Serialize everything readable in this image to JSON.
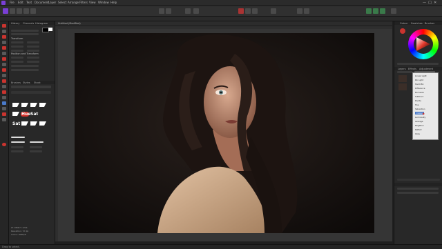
{
  "app": {
    "name": "Affinity Photo",
    "menu": [
      "File",
      "Edit",
      "Text",
      "Document",
      "Layer",
      "Select",
      "Arrange",
      "Filters",
      "View",
      "Window",
      "Help"
    ]
  },
  "left_panel": {
    "tabs": [
      "History",
      "Channels",
      "Histogram"
    ],
    "section_transform": "Transform",
    "section_position": "Position and Transform",
    "styles_tabs": [
      "Brushes",
      "Styles",
      "Stock"
    ],
    "swatch_labels": [
      "Hue",
      "Sat",
      "Sat"
    ],
    "info_lines": [
      "W: 1866 H: 1244",
      "Resolution: 72 dpi",
      "Colour: RGBA/8"
    ]
  },
  "document": {
    "tab_label": "Untitled (Modified)"
  },
  "right_panel": {
    "tabs": [
      "Colour",
      "Swatches",
      "Brushes"
    ],
    "layer_tabs": [
      "Layers",
      "Effects",
      "Adjustment"
    ],
    "blend_modes": [
      "Linear Light",
      "Pin Light",
      "Hard Mix",
      "Difference",
      "Exclusion",
      "Subtract",
      "Divide",
      "Hue",
      "Saturation",
      "Colour",
      "Luminosity",
      "Average",
      "Negation",
      "Reflect",
      "Glow"
    ]
  },
  "status": {
    "text": "Drag to select."
  },
  "colors": {
    "accent": "#c9342f",
    "panel": "#282828",
    "canvas": "#353535"
  }
}
